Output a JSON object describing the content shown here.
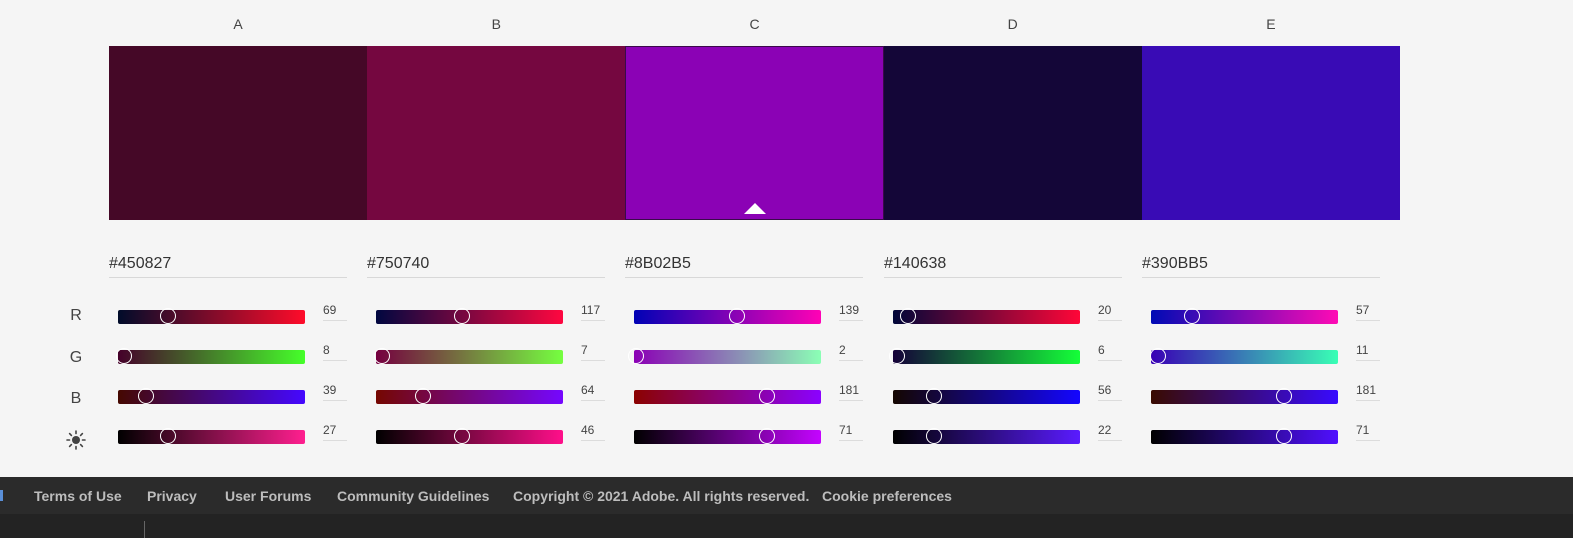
{
  "palette": {
    "columns": [
      {
        "label": "A",
        "hex": "#450827",
        "color": "#450827",
        "selected": false,
        "sliders": {
          "r": {
            "value": "69",
            "fraction": 0.27,
            "gradient": "linear-gradient(90deg,#000c2a,#ff0c2a)"
          },
          "g": {
            "value": "8",
            "fraction": 0.03,
            "gradient": "linear-gradient(90deg,#45002a,#45ff2a)"
          },
          "b": {
            "value": "39",
            "fraction": 0.15,
            "gradient": "linear-gradient(90deg,#450800,#4508ff)"
          },
          "k": {
            "value": "27",
            "fraction": 0.27,
            "gradient": "linear-gradient(90deg,#000000,#ff1f8f)"
          }
        }
      },
      {
        "label": "B",
        "hex": "#750740",
        "color": "#750740",
        "selected": false,
        "sliders": {
          "r": {
            "value": "117",
            "fraction": 0.46,
            "gradient": "linear-gradient(90deg,#000740,#ff0740)"
          },
          "g": {
            "value": "7",
            "fraction": 0.03,
            "gradient": "linear-gradient(90deg,#750040,#75ff40)"
          },
          "b": {
            "value": "64",
            "fraction": 0.25,
            "gradient": "linear-gradient(90deg,#750700,#7507ff)"
          },
          "k": {
            "value": "46",
            "fraction": 0.46,
            "gradient": "linear-gradient(90deg,#000000,#ff0f8a)"
          }
        }
      },
      {
        "label": "C",
        "hex": "#8B02B5",
        "color": "#8B02B5",
        "selected": true,
        "sliders": {
          "r": {
            "value": "139",
            "fraction": 0.55,
            "gradient": "linear-gradient(90deg,#0002b5,#ff02b5)"
          },
          "g": {
            "value": "2",
            "fraction": 0.01,
            "gradient": "linear-gradient(90deg,#8b00b5,#8bffb5)"
          },
          "b": {
            "value": "181",
            "fraction": 0.71,
            "gradient": "linear-gradient(90deg,#8b0200,#8b02ff)"
          },
          "k": {
            "value": "71",
            "fraction": 0.71,
            "gradient": "linear-gradient(90deg,#000000,#c404ff)"
          }
        }
      },
      {
        "label": "D",
        "hex": "#140638",
        "color": "#140638",
        "selected": false,
        "sliders": {
          "r": {
            "value": "20",
            "fraction": 0.08,
            "gradient": "linear-gradient(90deg,#000638,#ff0638)"
          },
          "g": {
            "value": "6",
            "fraction": 0.02,
            "gradient": "linear-gradient(90deg,#140038,#14ff38)"
          },
          "b": {
            "value": "56",
            "fraction": 0.22,
            "gradient": "linear-gradient(90deg,#140600,#1406ff)"
          },
          "k": {
            "value": "22",
            "fraction": 0.22,
            "gradient": "linear-gradient(90deg,#000000,#5a1bff)"
          }
        }
      },
      {
        "label": "E",
        "hex": "#390BB5",
        "color": "#390BB5",
        "selected": false,
        "sliders": {
          "r": {
            "value": "57",
            "fraction": 0.22,
            "gradient": "linear-gradient(90deg,#000bb5,#ff0bb5)"
          },
          "g": {
            "value": "11",
            "fraction": 0.04,
            "gradient": "linear-gradient(90deg,#3900b5,#39ffb5)"
          },
          "b": {
            "value": "181",
            "fraction": 0.71,
            "gradient": "linear-gradient(90deg,#390b00,#390bff)"
          },
          "k": {
            "value": "71",
            "fraction": 0.71,
            "gradient": "linear-gradient(90deg,#000000,#5010ff)"
          }
        }
      }
    ]
  },
  "row_labels": {
    "r": "R",
    "g": "G",
    "b": "B",
    "brightness_icon": "sun-icon"
  },
  "footer": {
    "links": [
      "Terms of Use",
      "Privacy",
      "User Forums",
      "Community Guidelines"
    ],
    "copyright": "Copyright © 2021 Adobe. All rights reserved.",
    "cookie": "Cookie preferences"
  }
}
